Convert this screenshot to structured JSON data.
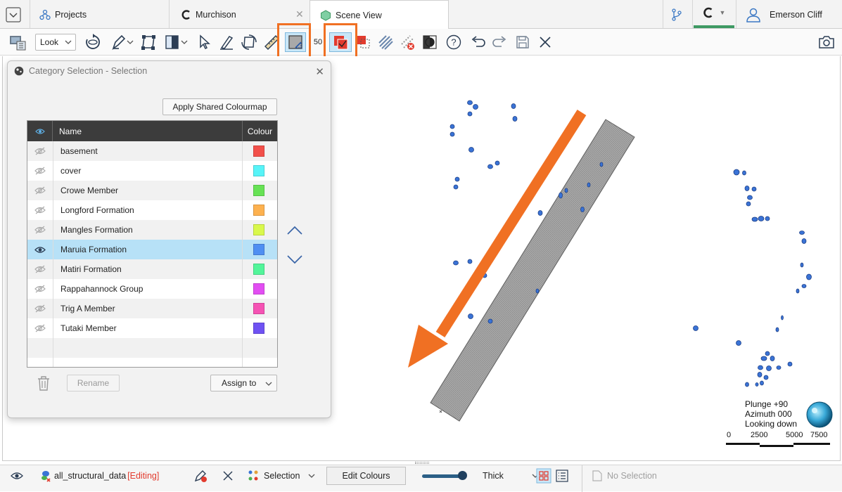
{
  "tabs": {
    "projects_label": "Projects",
    "murchison_label": "Murchison",
    "scene_label": "Scene View",
    "user_name": "Emerson Cliff"
  },
  "toolbar": {
    "look_label": "Look",
    "fifty_label": "50"
  },
  "dialog": {
    "title": "Category Selection - Selection",
    "apply_label": "Apply Shared Colourmap",
    "col_name": "Name",
    "col_colour": "Colour",
    "rename_label": "Rename",
    "assign_label": "Assign to",
    "rows": [
      {
        "name": "basement",
        "colour": "#f2504a",
        "visible": false
      },
      {
        "name": "cover",
        "colour": "#57f4f8",
        "visible": false
      },
      {
        "name": "Crowe Member",
        "colour": "#67e255",
        "visible": false
      },
      {
        "name": "Longford Formation",
        "colour": "#fdb14f",
        "visible": false
      },
      {
        "name": "Mangles Formation",
        "colour": "#d9f84c",
        "visible": false
      },
      {
        "name": "Maruia Formation",
        "colour": "#4f8ff2",
        "visible": true,
        "selected": true
      },
      {
        "name": "Matiri Formation",
        "colour": "#53f59a",
        "visible": false
      },
      {
        "name": "Rappahannock Group",
        "colour": "#e24ef2",
        "visible": false
      },
      {
        "name": "Trig A Member",
        "colour": "#f553b4",
        "visible": false
      },
      {
        "name": "Tutaki Member",
        "colour": "#6f52f3",
        "visible": false
      }
    ]
  },
  "navigation": {
    "plunge": "Plunge +90",
    "azimuth": "Azimuth 000",
    "looking": "Looking down",
    "scale_labels": [
      "0",
      "2500",
      "5000",
      "7500"
    ]
  },
  "bottombar": {
    "object_name": "all_structural_data",
    "editing_tag": "[Editing]",
    "selection_label": "Selection",
    "edit_colours_label": "Edit Colours",
    "thickness_label": "Thick",
    "no_selection_label": "No Selection"
  },
  "colors": {
    "accent_orange": "#f07023",
    "selected_row": "#b7e1f7",
    "point_blue": "#3a73d6",
    "active_tab_underline": "#3e9a63"
  }
}
